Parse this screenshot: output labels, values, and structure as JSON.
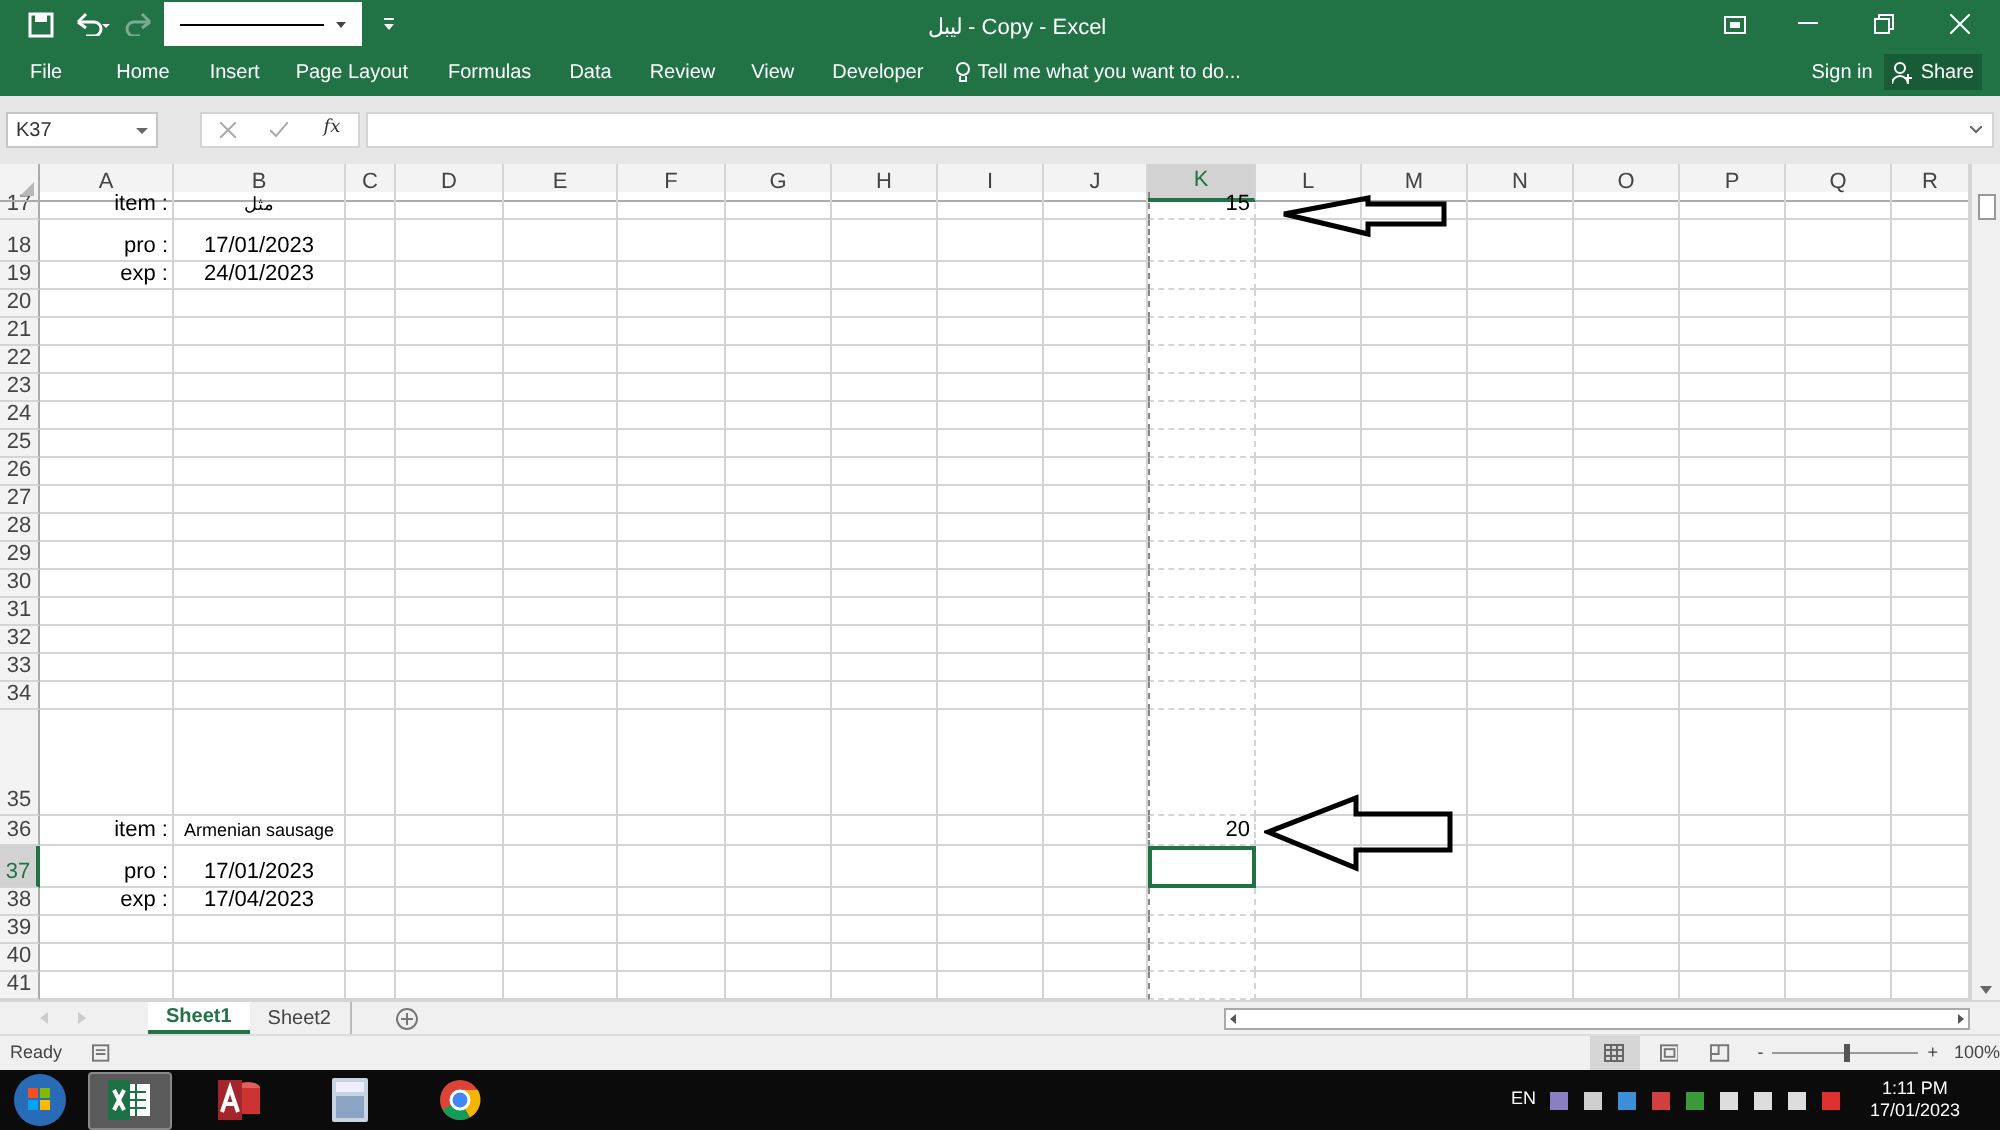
{
  "window": {
    "title": "لیبل - Copy - Excel"
  },
  "ribbon_tabs": [
    {
      "label": "File"
    },
    {
      "label": "Home"
    },
    {
      "label": "Insert"
    },
    {
      "label": "Page Layout"
    },
    {
      "label": "Formulas"
    },
    {
      "label": "Data"
    },
    {
      "label": "Review"
    },
    {
      "label": "View"
    },
    {
      "label": "Developer"
    }
  ],
  "tell_me": {
    "placeholder": "Tell me what you want to do..."
  },
  "account": {
    "sign_in": "Sign in",
    "share": "Share"
  },
  "formula_bar": {
    "name_box": "K37",
    "fx": "fx"
  },
  "columns": [
    {
      "label": "A",
      "selected": false
    },
    {
      "label": "B",
      "selected": false
    },
    {
      "label": "C",
      "selected": false
    },
    {
      "label": "D",
      "selected": false
    },
    {
      "label": "E",
      "selected": false
    },
    {
      "label": "F",
      "selected": false
    },
    {
      "label": "G",
      "selected": false
    },
    {
      "label": "H",
      "selected": false
    },
    {
      "label": "I",
      "selected": false
    },
    {
      "label": "J",
      "selected": false
    },
    {
      "label": "K",
      "selected": true
    },
    {
      "label": "L",
      "selected": false
    },
    {
      "label": "M",
      "selected": false
    },
    {
      "label": "N",
      "selected": false
    },
    {
      "label": "O",
      "selected": false
    },
    {
      "label": "P",
      "selected": false
    },
    {
      "label": "Q",
      "selected": false
    },
    {
      "label": "R",
      "selected": false
    }
  ],
  "rows": [
    {
      "number": "17",
      "selected": false,
      "cells": {
        "A": "item :",
        "B": "مثل",
        "K": "15"
      }
    },
    {
      "number": "18",
      "selected": false,
      "cells": {
        "A": "pro :",
        "B": "17/01/2023"
      }
    },
    {
      "number": "19",
      "selected": false,
      "cells": {
        "A": "exp :",
        "B": "24/01/2023"
      }
    },
    {
      "number": "20",
      "selected": false
    },
    {
      "number": "21",
      "selected": false
    },
    {
      "number": "22",
      "selected": false
    },
    {
      "number": "23",
      "selected": false
    },
    {
      "number": "24",
      "selected": false
    },
    {
      "number": "25",
      "selected": false
    },
    {
      "number": "26",
      "selected": false
    },
    {
      "number": "27",
      "selected": false
    },
    {
      "number": "28",
      "selected": false
    },
    {
      "number": "29",
      "selected": false
    },
    {
      "number": "30",
      "selected": false
    },
    {
      "number": "31",
      "selected": false
    },
    {
      "number": "32",
      "selected": false
    },
    {
      "number": "33",
      "selected": false
    },
    {
      "number": "34",
      "selected": false
    },
    {
      "number": "35",
      "selected": false
    },
    {
      "number": "36",
      "selected": false,
      "cells": {
        "A": "item :",
        "B": "Armenian sausage",
        "K": "20"
      }
    },
    {
      "number": "37",
      "selected": true,
      "cells": {
        "A": "pro :",
        "B": "17/01/2023"
      }
    },
    {
      "number": "38",
      "selected": false,
      "cells": {
        "A": "exp :",
        "B": "17/04/2023"
      }
    },
    {
      "number": "39",
      "selected": false
    },
    {
      "number": "40",
      "selected": false
    },
    {
      "number": "41",
      "selected": false
    }
  ],
  "sheet_tabs": [
    {
      "label": "Sheet1",
      "selected": true
    },
    {
      "label": "Sheet2",
      "selected": false
    }
  ],
  "status_bar": {
    "status": "Ready",
    "zoom_out": "-",
    "zoom_in": "+",
    "zoom": "100%",
    "zoom_level": {
      "level": 0.5
    }
  },
  "taskbar": {
    "apps": [
      {
        "kind": "excel",
        "active": true
      },
      {
        "kind": "access",
        "active": false
      },
      {
        "kind": "calculator",
        "active": false
      },
      {
        "kind": "chrome",
        "active": false
      }
    ],
    "language": "EN",
    "time": "1:11 PM",
    "date": "17/01/2023"
  }
}
